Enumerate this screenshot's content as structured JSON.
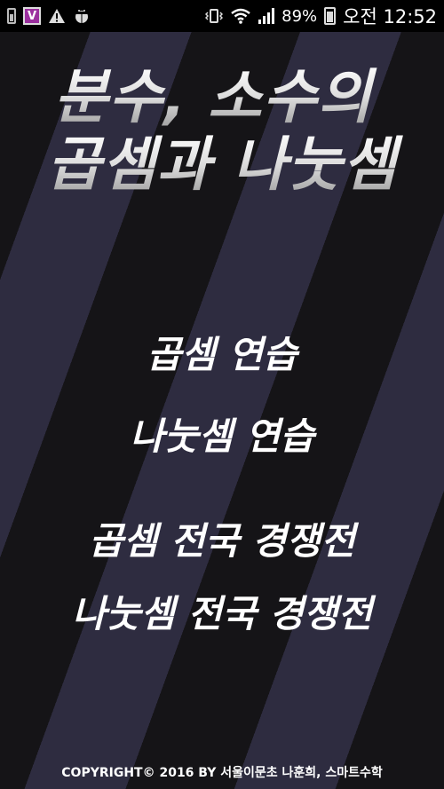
{
  "status_bar": {
    "battery_percent": "89%",
    "time": "오전 12:52",
    "icons": [
      "battery-small-icon",
      "v-app-icon",
      "warning-icon",
      "android-debug-icon",
      "vibrate-icon",
      "wifi-icon",
      "signal-icon",
      "battery-icon"
    ],
    "v_label": "V"
  },
  "title": {
    "line1": "분수, 소수의",
    "line2": "곱셈과 나눗셈"
  },
  "menu": {
    "multiplication_practice": "곱셈 연습",
    "division_practice": "나눗셈 연습",
    "multiplication_contest": "곱셈 전국 경쟁전",
    "division_contest": "나눗셈 전국 경쟁전"
  },
  "footer": {
    "copyright": "COPYRIGHT© 2016 BY 서울이문초 나훈희, 스마트수학"
  }
}
